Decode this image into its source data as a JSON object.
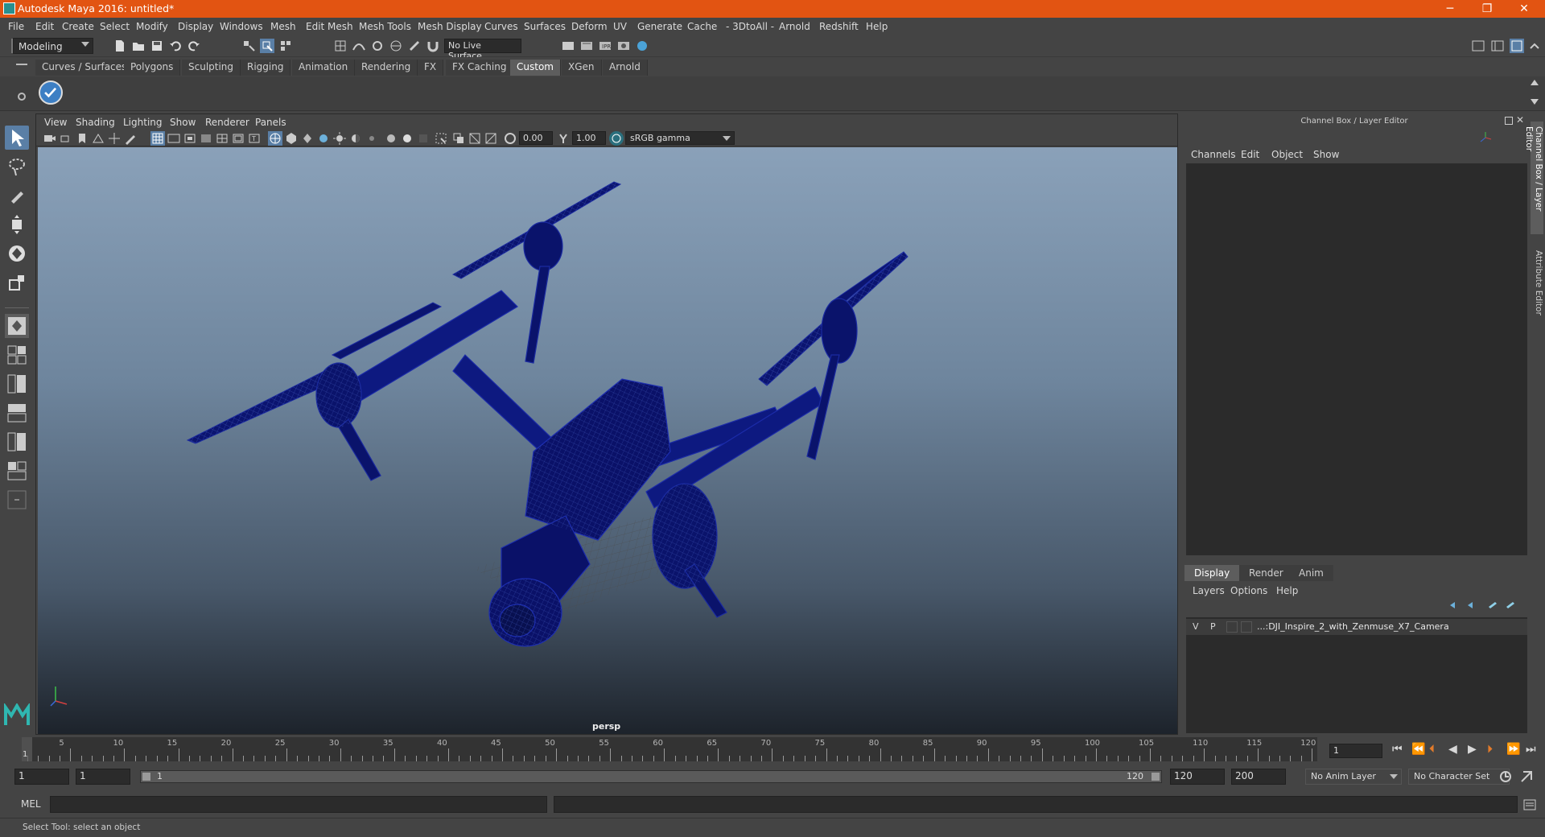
{
  "titlebar": {
    "title": "Autodesk Maya 2016: untitled*",
    "minimize": "─",
    "restore": "❐",
    "close": "✕"
  },
  "menu": [
    "File",
    "Edit",
    "Create",
    "Select",
    "Modify",
    "Display",
    "Windows",
    "Mesh",
    "Edit Mesh",
    "Mesh Tools",
    "Mesh Display",
    "Curves",
    "Surfaces",
    "Deform",
    "UV",
    "Generate",
    "Cache",
    "- 3DtoAll -",
    "Arnold",
    "Redshift",
    "Help"
  ],
  "statusline": {
    "mode": "Modeling",
    "live_surface": "No Live Surface"
  },
  "shelf_tabs": [
    "Curves / Surfaces",
    "Polygons",
    "Sculpting",
    "Rigging",
    "Animation",
    "Rendering",
    "FX",
    "FX Caching",
    "Custom",
    "XGen",
    "Arnold"
  ],
  "shelf_active": "Custom",
  "viewport": {
    "menu": [
      "View",
      "Shading",
      "Lighting",
      "Show",
      "Renderer",
      "Panels"
    ],
    "exposure": "0.00",
    "gamma": "1.00",
    "color_space": "sRGB gamma",
    "camera_label": "persp"
  },
  "right_panel": {
    "title": "Channel Box / Layer Editor",
    "menu": [
      "Channels",
      "Edit",
      "Object",
      "Show"
    ],
    "tabs": [
      "Display",
      "Render",
      "Anim"
    ],
    "layer_menu": [
      "Layers",
      "Options",
      "Help"
    ],
    "layer": {
      "v": "V",
      "p": "P",
      "name": "...:DJI_Inspire_2_with_Zenmuse_X7_Camera"
    }
  },
  "side_tabs": [
    "Channel Box / Layer Editor",
    "Attribute Editor"
  ],
  "timeline": {
    "ticks": [
      5,
      10,
      15,
      20,
      25,
      30,
      35,
      40,
      45,
      50,
      55,
      60,
      65,
      70,
      75,
      80,
      85,
      90,
      95,
      100,
      105,
      110,
      115,
      120
    ],
    "first": "1",
    "current_frame": "1"
  },
  "range": {
    "start": "1",
    "inner_start": "1",
    "slider_start": "1",
    "slider_end": "120",
    "end": "120",
    "max": "200",
    "anim_layer": "No Anim Layer",
    "char_set": "No Character Set"
  },
  "cmdline": {
    "label": "MEL"
  },
  "helpline": {
    "text": "Select Tool: select an object"
  },
  "colors": {
    "titlebar": "#e25412",
    "wire": "#0b1470",
    "accent": "#5a7fa6"
  }
}
